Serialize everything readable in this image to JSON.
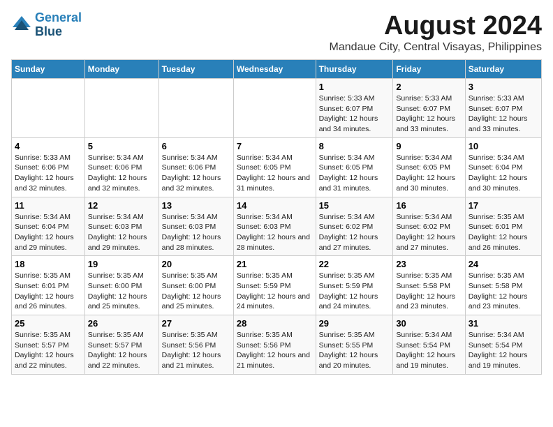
{
  "logo": {
    "line1": "General",
    "line2": "Blue"
  },
  "title": "August 2024",
  "subtitle": "Mandaue City, Central Visayas, Philippines",
  "headers": [
    "Sunday",
    "Monday",
    "Tuesday",
    "Wednesday",
    "Thursday",
    "Friday",
    "Saturday"
  ],
  "weeks": [
    [
      {
        "day": "",
        "sunrise": "",
        "sunset": "",
        "daylight": ""
      },
      {
        "day": "",
        "sunrise": "",
        "sunset": "",
        "daylight": ""
      },
      {
        "day": "",
        "sunrise": "",
        "sunset": "",
        "daylight": ""
      },
      {
        "day": "",
        "sunrise": "",
        "sunset": "",
        "daylight": ""
      },
      {
        "day": "1",
        "sunrise": "Sunrise: 5:33 AM",
        "sunset": "Sunset: 6:07 PM",
        "daylight": "Daylight: 12 hours and 34 minutes."
      },
      {
        "day": "2",
        "sunrise": "Sunrise: 5:33 AM",
        "sunset": "Sunset: 6:07 PM",
        "daylight": "Daylight: 12 hours and 33 minutes."
      },
      {
        "day": "3",
        "sunrise": "Sunrise: 5:33 AM",
        "sunset": "Sunset: 6:07 PM",
        "daylight": "Daylight: 12 hours and 33 minutes."
      }
    ],
    [
      {
        "day": "4",
        "sunrise": "Sunrise: 5:33 AM",
        "sunset": "Sunset: 6:06 PM",
        "daylight": "Daylight: 12 hours and 32 minutes."
      },
      {
        "day": "5",
        "sunrise": "Sunrise: 5:34 AM",
        "sunset": "Sunset: 6:06 PM",
        "daylight": "Daylight: 12 hours and 32 minutes."
      },
      {
        "day": "6",
        "sunrise": "Sunrise: 5:34 AM",
        "sunset": "Sunset: 6:06 PM",
        "daylight": "Daylight: 12 hours and 32 minutes."
      },
      {
        "day": "7",
        "sunrise": "Sunrise: 5:34 AM",
        "sunset": "Sunset: 6:05 PM",
        "daylight": "Daylight: 12 hours and 31 minutes."
      },
      {
        "day": "8",
        "sunrise": "Sunrise: 5:34 AM",
        "sunset": "Sunset: 6:05 PM",
        "daylight": "Daylight: 12 hours and 31 minutes."
      },
      {
        "day": "9",
        "sunrise": "Sunrise: 5:34 AM",
        "sunset": "Sunset: 6:05 PM",
        "daylight": "Daylight: 12 hours and 30 minutes."
      },
      {
        "day": "10",
        "sunrise": "Sunrise: 5:34 AM",
        "sunset": "Sunset: 6:04 PM",
        "daylight": "Daylight: 12 hours and 30 minutes."
      }
    ],
    [
      {
        "day": "11",
        "sunrise": "Sunrise: 5:34 AM",
        "sunset": "Sunset: 6:04 PM",
        "daylight": "Daylight: 12 hours and 29 minutes."
      },
      {
        "day": "12",
        "sunrise": "Sunrise: 5:34 AM",
        "sunset": "Sunset: 6:03 PM",
        "daylight": "Daylight: 12 hours and 29 minutes."
      },
      {
        "day": "13",
        "sunrise": "Sunrise: 5:34 AM",
        "sunset": "Sunset: 6:03 PM",
        "daylight": "Daylight: 12 hours and 28 minutes."
      },
      {
        "day": "14",
        "sunrise": "Sunrise: 5:34 AM",
        "sunset": "Sunset: 6:03 PM",
        "daylight": "Daylight: 12 hours and 28 minutes."
      },
      {
        "day": "15",
        "sunrise": "Sunrise: 5:34 AM",
        "sunset": "Sunset: 6:02 PM",
        "daylight": "Daylight: 12 hours and 27 minutes."
      },
      {
        "day": "16",
        "sunrise": "Sunrise: 5:34 AM",
        "sunset": "Sunset: 6:02 PM",
        "daylight": "Daylight: 12 hours and 27 minutes."
      },
      {
        "day": "17",
        "sunrise": "Sunrise: 5:35 AM",
        "sunset": "Sunset: 6:01 PM",
        "daylight": "Daylight: 12 hours and 26 minutes."
      }
    ],
    [
      {
        "day": "18",
        "sunrise": "Sunrise: 5:35 AM",
        "sunset": "Sunset: 6:01 PM",
        "daylight": "Daylight: 12 hours and 26 minutes."
      },
      {
        "day": "19",
        "sunrise": "Sunrise: 5:35 AM",
        "sunset": "Sunset: 6:00 PM",
        "daylight": "Daylight: 12 hours and 25 minutes."
      },
      {
        "day": "20",
        "sunrise": "Sunrise: 5:35 AM",
        "sunset": "Sunset: 6:00 PM",
        "daylight": "Daylight: 12 hours and 25 minutes."
      },
      {
        "day": "21",
        "sunrise": "Sunrise: 5:35 AM",
        "sunset": "Sunset: 5:59 PM",
        "daylight": "Daylight: 12 hours and 24 minutes."
      },
      {
        "day": "22",
        "sunrise": "Sunrise: 5:35 AM",
        "sunset": "Sunset: 5:59 PM",
        "daylight": "Daylight: 12 hours and 24 minutes."
      },
      {
        "day": "23",
        "sunrise": "Sunrise: 5:35 AM",
        "sunset": "Sunset: 5:58 PM",
        "daylight": "Daylight: 12 hours and 23 minutes."
      },
      {
        "day": "24",
        "sunrise": "Sunrise: 5:35 AM",
        "sunset": "Sunset: 5:58 PM",
        "daylight": "Daylight: 12 hours and 23 minutes."
      }
    ],
    [
      {
        "day": "25",
        "sunrise": "Sunrise: 5:35 AM",
        "sunset": "Sunset: 5:57 PM",
        "daylight": "Daylight: 12 hours and 22 minutes."
      },
      {
        "day": "26",
        "sunrise": "Sunrise: 5:35 AM",
        "sunset": "Sunset: 5:57 PM",
        "daylight": "Daylight: 12 hours and 22 minutes."
      },
      {
        "day": "27",
        "sunrise": "Sunrise: 5:35 AM",
        "sunset": "Sunset: 5:56 PM",
        "daylight": "Daylight: 12 hours and 21 minutes."
      },
      {
        "day": "28",
        "sunrise": "Sunrise: 5:35 AM",
        "sunset": "Sunset: 5:56 PM",
        "daylight": "Daylight: 12 hours and 21 minutes."
      },
      {
        "day": "29",
        "sunrise": "Sunrise: 5:35 AM",
        "sunset": "Sunset: 5:55 PM",
        "daylight": "Daylight: 12 hours and 20 minutes."
      },
      {
        "day": "30",
        "sunrise": "Sunrise: 5:34 AM",
        "sunset": "Sunset: 5:54 PM",
        "daylight": "Daylight: 12 hours and 19 minutes."
      },
      {
        "day": "31",
        "sunrise": "Sunrise: 5:34 AM",
        "sunset": "Sunset: 5:54 PM",
        "daylight": "Daylight: 12 hours and 19 minutes."
      }
    ]
  ]
}
